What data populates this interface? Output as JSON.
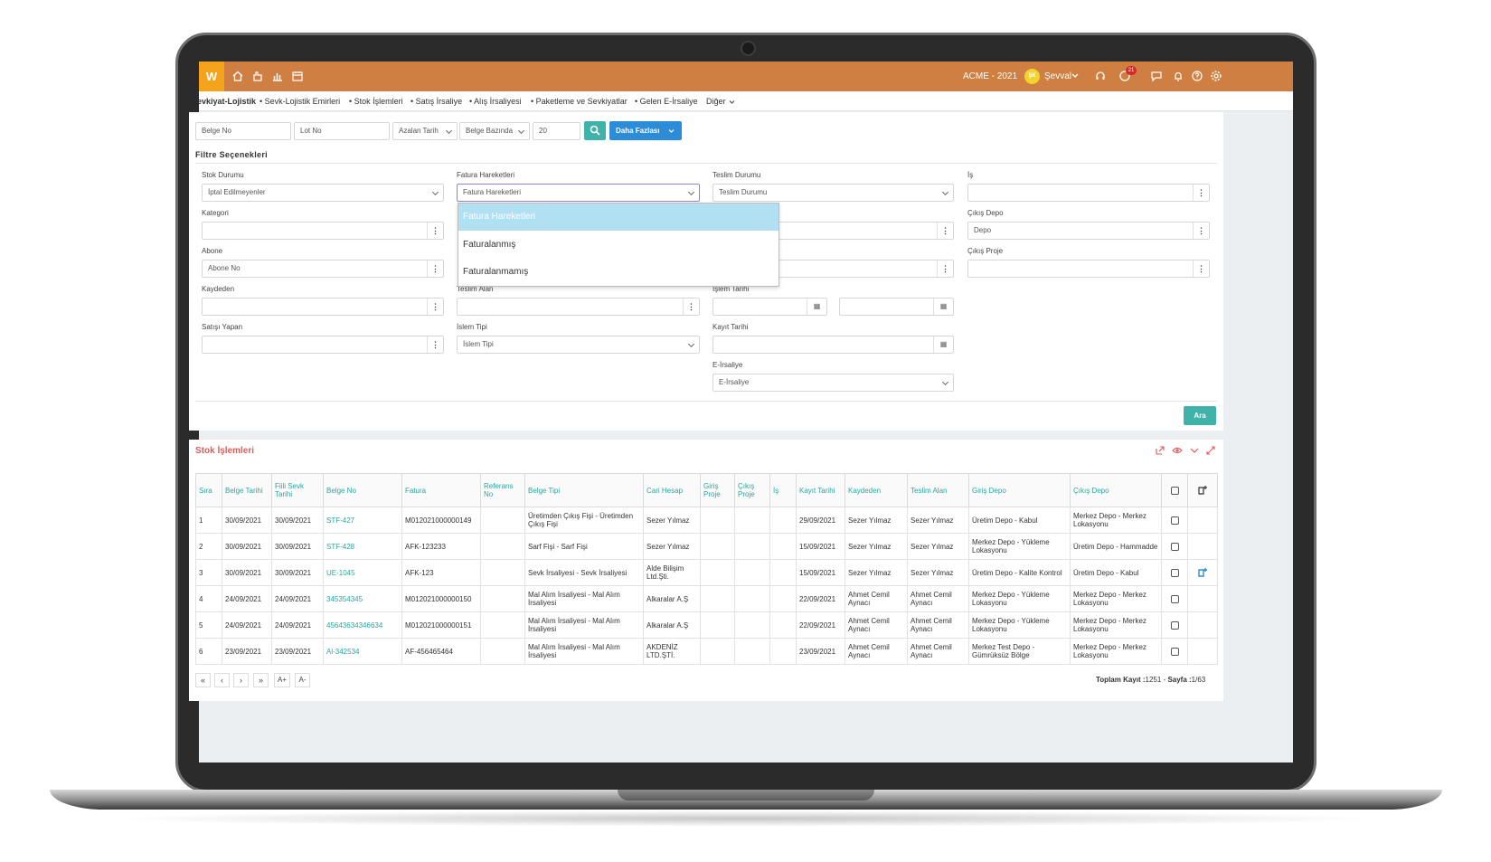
{
  "topbar": {
    "logo": "W",
    "company": "ACME - 2021",
    "avatar_initials": "ŞK",
    "user": "Şevval",
    "notif_count": "21"
  },
  "nav": {
    "active": "Sevkiyat-Lojistik",
    "items": [
      "• Sevk-Lojistik Emirleri",
      "• Stok İşlemleri",
      "• Satış İrsaliye",
      "• Alış İrsaliyesi",
      "• Paketleme ve Sevkiyatlar",
      "• Gelen E-İrsaliye"
    ],
    "more": "Diğer"
  },
  "search": {
    "belge_no": "Belge No",
    "lot_no": "Lot No",
    "sort": "Azalan Tarih",
    "group": "Belge Bazında",
    "page_size": "20",
    "more_button": "Daha Fazlası"
  },
  "filters": {
    "title": "Filtre Seçenekleri",
    "stok_durumu_label": "Stok Durumu",
    "stok_durumu_value": "İptal Edilmeyenler",
    "fatura_label": "Fatura Hareketleri",
    "fatura_value": "Fatura Hareketleri",
    "teslim_durumu_label": "Teslim Durumu",
    "teslim_durumu_value": "Teslim Durumu",
    "is_label": "İş",
    "kategori_label": "Kategori",
    "cikis_depo_label": "Çıkış Depo",
    "cikis_depo_value": "Depo",
    "abone_label": "Abone",
    "abone_value": "Abone No",
    "cikis_proje_label": "Çıkış Proje",
    "kaydeden_label": "Kaydeden",
    "teslim_alan_label": "Teslim Alan",
    "islem_tarihi_label": "İşlem Tarihi",
    "satisi_yapan_label": "Satışı Yapan",
    "islem_tipi_label": "İslem Tipi",
    "islem_tipi_value": "İslem Tipi",
    "kayit_tarihi_label": "Kayıt Tarihi",
    "eirsaliye_label": "E-İrsaliye",
    "eirsaliye_value": "E-İrsaliye",
    "search_button": "Ara"
  },
  "dropdown": {
    "options": [
      "Fatura Hareketleri",
      "Faturalanmış",
      "Faturalanmamış"
    ],
    "highlight_color": "#b1e0f3"
  },
  "list": {
    "title": "Stok İşlemleri",
    "headers": [
      "Sıra",
      "Belge Tarihi",
      "Fiili Sevk Tarihi",
      "Belge No",
      "Fatura",
      "Referans No",
      "Belge Tipi",
      "Cari Hesap",
      "Giriş Proje",
      "Çıkış Proje",
      "İş",
      "Kayıt Tarihi",
      "Kaydeden",
      "Teslim Alan",
      "Giriş Depo",
      "Çıkış Depo"
    ],
    "rows": [
      [
        "1",
        "30/09/2021",
        "30/09/2021",
        "STF-427",
        "M012021000000149",
        "",
        "Üretimden Çıkış Fişi - Üretimden Çıkış Fişi",
        "Sezer Yılmaz",
        "",
        "",
        "",
        "29/09/2021",
        "Sezer Yılmaz",
        "Sezer Yılmaz",
        "Üretim Depo - Kabul",
        "Merkez Depo - Merkez Lokasyonu"
      ],
      [
        "2",
        "30/09/2021",
        "30/09/2021",
        "STF-428",
        "AFK-123233",
        "",
        "Sarf Fişi - Sarf Fişi",
        "Sezer Yılmaz",
        "",
        "",
        "",
        "15/09/2021",
        "Sezer Yılmaz",
        "Sezer Yılmaz",
        "Merkez Depo - Yükleme Lokasyonu",
        "Üretim Depo - Hammadde"
      ],
      [
        "3",
        "30/09/2021",
        "30/09/2021",
        "UE-1045",
        "AFK-123",
        "",
        "Sevk İrsaliyesi - Sevk İrsaliyesi",
        "Alde Bilişim Ltd.Şti.",
        "",
        "",
        "",
        "15/09/2021",
        "Sezer Yılmaz",
        "Sezer Yılmaz",
        "Üretim Depo - Kalite Kontrol",
        "Üretim Depo - Kabul"
      ],
      [
        "4",
        "24/09/2021",
        "24/09/2021",
        "345354345",
        "M012021000000150",
        "",
        "Mal Alım İrsaliyesi - Mal Alım İrsaliyesi",
        "Alkaralar A.Ş",
        "",
        "",
        "",
        "22/09/2021",
        "Ahmet Cemil Aynacı",
        "Ahmet Cemil Aynacı",
        "Merkez Depo - Yükleme Lokasyonu",
        "Merkez Depo - Merkez Lokasyonu"
      ],
      [
        "5",
        "24/09/2021",
        "24/09/2021",
        "45643634346634",
        "M012021000000151",
        "",
        "Mal Alım İrsaliyesi - Mal Alım İrsaliyesi",
        "Alkaralar A.Ş",
        "",
        "",
        "",
        "22/09/2021",
        "Ahmet Cemil Aynacı",
        "Ahmet Cemil Aynacı",
        "Merkez Depo - Yükleme Lokasyonu",
        "Merkez Depo - Merkez Lokasyonu"
      ],
      [
        "6",
        "23/09/2021",
        "23/09/2021",
        "Al-342534",
        "AF-456465464",
        "",
        "Mal Alım İrsaliyesi - Mal Alım İrsaliyesi",
        "AKDENİZ LTD.ŞTİ.",
        "",
        "",
        "",
        "23/09/2021",
        "Ahmet Cemil Aynacı",
        "Ahmet Cemil Aynacı",
        "Merkez Test Depo - Gümrüksüz Bölge",
        "Merkez Depo - Merkez Lokasyonu"
      ]
    ],
    "font_up": "A+",
    "font_down": "A-",
    "total_label": "Toplam Kayıt :",
    "total_value": "1251",
    "page_label": "Sayfa :",
    "page_value": "1/63"
  },
  "colors": {
    "topbar": "#cf7f41",
    "accent_teal": "#3fb3a9",
    "accent_blue": "#2d8cd8",
    "title_red": "#e05a5a"
  }
}
